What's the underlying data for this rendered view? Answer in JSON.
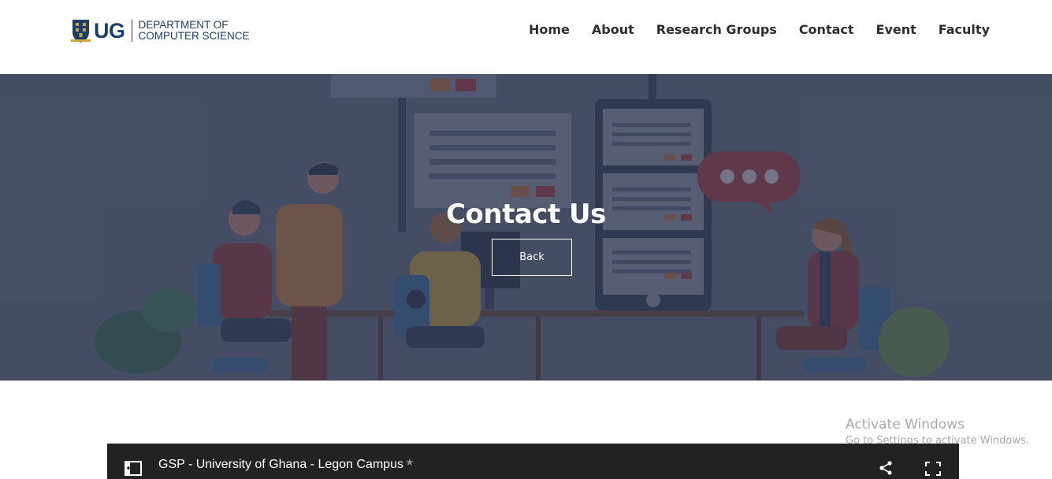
{
  "header": {
    "logo": {
      "short": "UG",
      "line1": "DEPARTMENT OF",
      "line2": "COMPUTER SCIENCE",
      "icon": "crest-icon"
    },
    "nav": [
      "Home",
      "About",
      "Research Groups",
      "Contact",
      "Event",
      "Faculty"
    ]
  },
  "hero": {
    "title": "Contact Us",
    "button": "Back",
    "illustration": "team-office-illustration"
  },
  "map": {
    "title": "GSP - University of Ghana - Legon Campus",
    "star": "★",
    "icons": [
      "map-panel-icon",
      "share-icon",
      "fullscreen-icon"
    ]
  },
  "watermark": {
    "line1": "Activate Windows",
    "line2": "Go to Settings to activate Windows."
  },
  "colors": {
    "brand_navy": "#1d3d6b",
    "hero_overlay": "#3a4258",
    "map_bar": "#222222"
  }
}
